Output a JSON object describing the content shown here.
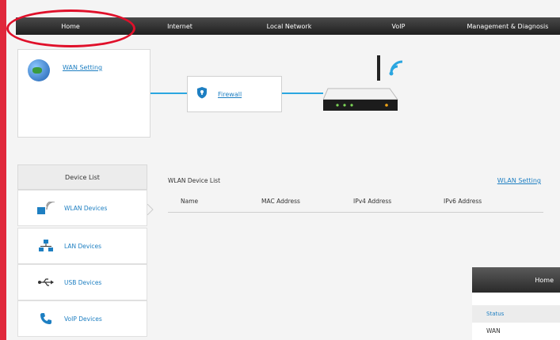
{
  "nav": {
    "tabs": [
      "Home",
      "Internet",
      "Local Network",
      "VoIP",
      "Management & Diagnosis"
    ]
  },
  "topology": {
    "wan_link": "WAN Setting",
    "firewall_link": "Firewall"
  },
  "device_list": {
    "title": "Device List",
    "items": [
      {
        "label": "WLAN Devices",
        "icon": "wifi-device-icon"
      },
      {
        "label": "LAN Devices",
        "icon": "network-icon"
      },
      {
        "label": "USB Devices",
        "icon": "usb-icon"
      },
      {
        "label": "VoIP Devices",
        "icon": "phone-icon"
      }
    ]
  },
  "main": {
    "title": "WLAN Device List",
    "settings_link": "WLAN Setting",
    "columns": [
      "Name",
      "MAC Address",
      "IPv4 Address",
      "IPv6 Address"
    ]
  },
  "home_panel": {
    "header": "Home",
    "status_label": "Status",
    "wan_label": "WAN"
  },
  "colors": {
    "accent": "#1e7fc2",
    "line": "#2ba6e0",
    "highlight": "#e0102a"
  }
}
